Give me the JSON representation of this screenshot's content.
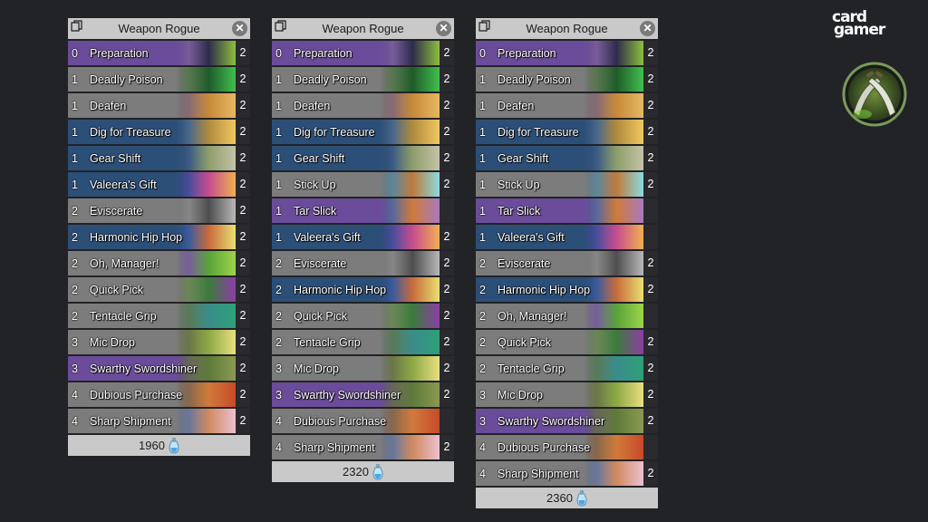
{
  "logo_lines": [
    "card",
    "gamer"
  ],
  "decks": [
    {
      "title": "Weapon Rogue",
      "dust": "1960",
      "cards": [
        {
          "cost": "0",
          "name": "Preparation",
          "count": "2",
          "color": "purple",
          "art": "#7c5f9e,#2e2c4c,#8dbf3c"
        },
        {
          "cost": "1",
          "name": "Deadly Poison",
          "count": "2",
          "color": "gray",
          "art": "#5b7a52,#1f5b2a,#41c04e"
        },
        {
          "cost": "1",
          "name": "Deafen",
          "count": "2",
          "color": "gray",
          "art": "#8b6d77,#c78a3a,#e6b862"
        },
        {
          "cost": "1",
          "name": "Dig for Treasure",
          "count": "2",
          "color": "blue",
          "art": "#4a6a8f,#b08a3c,#f0c860"
        },
        {
          "cost": "1",
          "name": "Gear Shift",
          "count": "2",
          "color": "blue",
          "art": "#3d5d88,#8e9e6a,#c5c2a8"
        },
        {
          "cost": "1",
          "name": "Valeera's Gift",
          "count": "2",
          "color": "blue",
          "art": "#4b4fa0,#c74c8f,#f0b050"
        },
        {
          "cost": "2",
          "name": "Eviscerate",
          "count": "2",
          "color": "gray",
          "art": "#8a8a8a,#4e4e4e,#b8b8b8"
        },
        {
          "cost": "2",
          "name": "Harmonic Hip Hop",
          "count": "2",
          "color": "blue",
          "art": "#3e5da0,#c86b3c,#e9e071"
        },
        {
          "cost": "2",
          "name": "Oh, Manager!",
          "count": "2",
          "color": "gray",
          "art": "#7a62a0,#5aa33a,#9dd44a"
        },
        {
          "cost": "2",
          "name": "Quick Pick",
          "count": "2",
          "color": "gray",
          "art": "#6e8a5a,#3c7a3c,#8d3ea5"
        },
        {
          "cost": "2",
          "name": "Tentacle Grip",
          "count": "2",
          "color": "gray",
          "art": "#5b7d5a,#3a8c8a,#2ea078"
        },
        {
          "cost": "3",
          "name": "Mic Drop",
          "count": "2",
          "color": "gray",
          "art": "#6e7a4a,#8da844,#e9e080"
        },
        {
          "cost": "3",
          "name": "Swarthy Swordshiner",
          "count": "2",
          "color": "purple",
          "art": "#6a6a5a,#5e7a3a,#8b9a50"
        },
        {
          "cost": "4",
          "name": "Dubious Purchase",
          "count": "2",
          "color": "gray",
          "art": "#8b6a50,#d07a3a,#c84a2a"
        },
        {
          "cost": "4",
          "name": "Sharp Shipment",
          "count": "2",
          "color": "gray",
          "art": "#6a7aa0,#d08a60,#ecc0d0"
        }
      ]
    },
    {
      "title": "Weapon Rogue",
      "dust": "2320",
      "cards": [
        {
          "cost": "0",
          "name": "Preparation",
          "count": "2",
          "color": "purple",
          "art": "#7c5f9e,#2e2c4c,#8dbf3c"
        },
        {
          "cost": "1",
          "name": "Deadly Poison",
          "count": "2",
          "color": "gray",
          "art": "#5b7a52,#1f5b2a,#41c04e"
        },
        {
          "cost": "1",
          "name": "Deafen",
          "count": "2",
          "color": "gray",
          "art": "#8b6d77,#c78a3a,#e6b862"
        },
        {
          "cost": "1",
          "name": "Dig for Treasure",
          "count": "2",
          "color": "blue",
          "art": "#4a6a8f,#b08a3c,#f0c860"
        },
        {
          "cost": "1",
          "name": "Gear Shift",
          "count": "2",
          "color": "blue",
          "art": "#3d5d88,#8e9e6a,#c5c2a8"
        },
        {
          "cost": "1",
          "name": "Stick Up",
          "count": "2",
          "color": "gray",
          "art": "#5e8aa0,#c07a3c,#8adbe0"
        },
        {
          "cost": "1",
          "name": "Tar Slick",
          "count": "",
          "color": "purple",
          "art": "#5b6aa0,#d07a3a,#a87ac0"
        },
        {
          "cost": "1",
          "name": "Valeera's Gift",
          "count": "2",
          "color": "blue",
          "art": "#4b4fa0,#c74c8f,#f0b050"
        },
        {
          "cost": "2",
          "name": "Eviscerate",
          "count": "2",
          "color": "gray",
          "art": "#8a8a8a,#4e4e4e,#b8b8b8"
        },
        {
          "cost": "2",
          "name": "Harmonic Hip Hop",
          "count": "2",
          "color": "blue",
          "art": "#3e5da0,#c86b3c,#e9e071"
        },
        {
          "cost": "2",
          "name": "Quick Pick",
          "count": "2",
          "color": "gray",
          "art": "#6e8a5a,#3c7a3c,#8d3ea5"
        },
        {
          "cost": "2",
          "name": "Tentacle Grip",
          "count": "2",
          "color": "gray",
          "art": "#5b7d5a,#3a8c8a,#2ea078"
        },
        {
          "cost": "3",
          "name": "Mic Drop",
          "count": "2",
          "color": "gray",
          "art": "#6e7a4a,#8da844,#e9e080"
        },
        {
          "cost": "3",
          "name": "Swarthy Swordshiner",
          "count": "2",
          "color": "purple",
          "art": "#6a6a5a,#5e7a3a,#8b9a50"
        },
        {
          "cost": "4",
          "name": "Dubious Purchase",
          "count": "",
          "color": "gray",
          "art": "#8b6a50,#d07a3a,#c84a2a"
        },
        {
          "cost": "4",
          "name": "Sharp Shipment",
          "count": "2",
          "color": "gray",
          "art": "#6a7aa0,#d08a60,#ecc0d0"
        }
      ]
    },
    {
      "title": "Weapon Rogue",
      "dust": "2360",
      "cards": [
        {
          "cost": "0",
          "name": "Preparation",
          "count": "2",
          "color": "purple",
          "art": "#7c5f9e,#2e2c4c,#8dbf3c"
        },
        {
          "cost": "1",
          "name": "Deadly Poison",
          "count": "2",
          "color": "gray",
          "art": "#5b7a52,#1f5b2a,#41c04e"
        },
        {
          "cost": "1",
          "name": "Deafen",
          "count": "2",
          "color": "gray",
          "art": "#8b6d77,#c78a3a,#e6b862"
        },
        {
          "cost": "1",
          "name": "Dig for Treasure",
          "count": "2",
          "color": "blue",
          "art": "#4a6a8f,#b08a3c,#f0c860"
        },
        {
          "cost": "1",
          "name": "Gear Shift",
          "count": "2",
          "color": "blue",
          "art": "#3d5d88,#8e9e6a,#c5c2a8"
        },
        {
          "cost": "1",
          "name": "Stick Up",
          "count": "2",
          "color": "gray",
          "art": "#5e8aa0,#c07a3c,#8adbe0"
        },
        {
          "cost": "1",
          "name": "Tar Slick",
          "count": "",
          "color": "purple",
          "art": "#5b6aa0,#d07a3a,#a87ac0"
        },
        {
          "cost": "1",
          "name": "Valeera's Gift",
          "count": "",
          "color": "blue",
          "art": "#4b4fa0,#c74c8f,#f0b050"
        },
        {
          "cost": "2",
          "name": "Eviscerate",
          "count": "2",
          "color": "gray",
          "art": "#8a8a8a,#4e4e4e,#b8b8b8"
        },
        {
          "cost": "2",
          "name": "Harmonic Hip Hop",
          "count": "2",
          "color": "blue",
          "art": "#3e5da0,#c86b3c,#e9e071"
        },
        {
          "cost": "2",
          "name": "Oh, Manager!",
          "count": "",
          "color": "gray",
          "art": "#7a62a0,#5aa33a,#9dd44a"
        },
        {
          "cost": "2",
          "name": "Quick Pick",
          "count": "2",
          "color": "gray",
          "art": "#6e8a5a,#3c7a3c,#8d3ea5"
        },
        {
          "cost": "2",
          "name": "Tentacle Grip",
          "count": "2",
          "color": "gray",
          "art": "#5b7d5a,#3a8c8a,#2ea078"
        },
        {
          "cost": "3",
          "name": "Mic Drop",
          "count": "2",
          "color": "gray",
          "art": "#6e7a4a,#8da844,#e9e080"
        },
        {
          "cost": "3",
          "name": "Swarthy Swordshiner",
          "count": "2",
          "color": "purple",
          "art": "#6a6a5a,#5e7a3a,#8b9a50"
        },
        {
          "cost": "4",
          "name": "Dubious Purchase",
          "count": "",
          "color": "gray",
          "art": "#8b6a50,#d07a3a,#c84a2a"
        },
        {
          "cost": "4",
          "name": "Sharp Shipment",
          "count": "2",
          "color": "gray",
          "art": "#6a7aa0,#d08a60,#ecc0d0"
        }
      ]
    }
  ],
  "icons": {
    "copy": "copy-icon",
    "close": "close-icon",
    "dust": "dust-vial-icon",
    "class_badge": "rogue-class-badge-icon"
  }
}
